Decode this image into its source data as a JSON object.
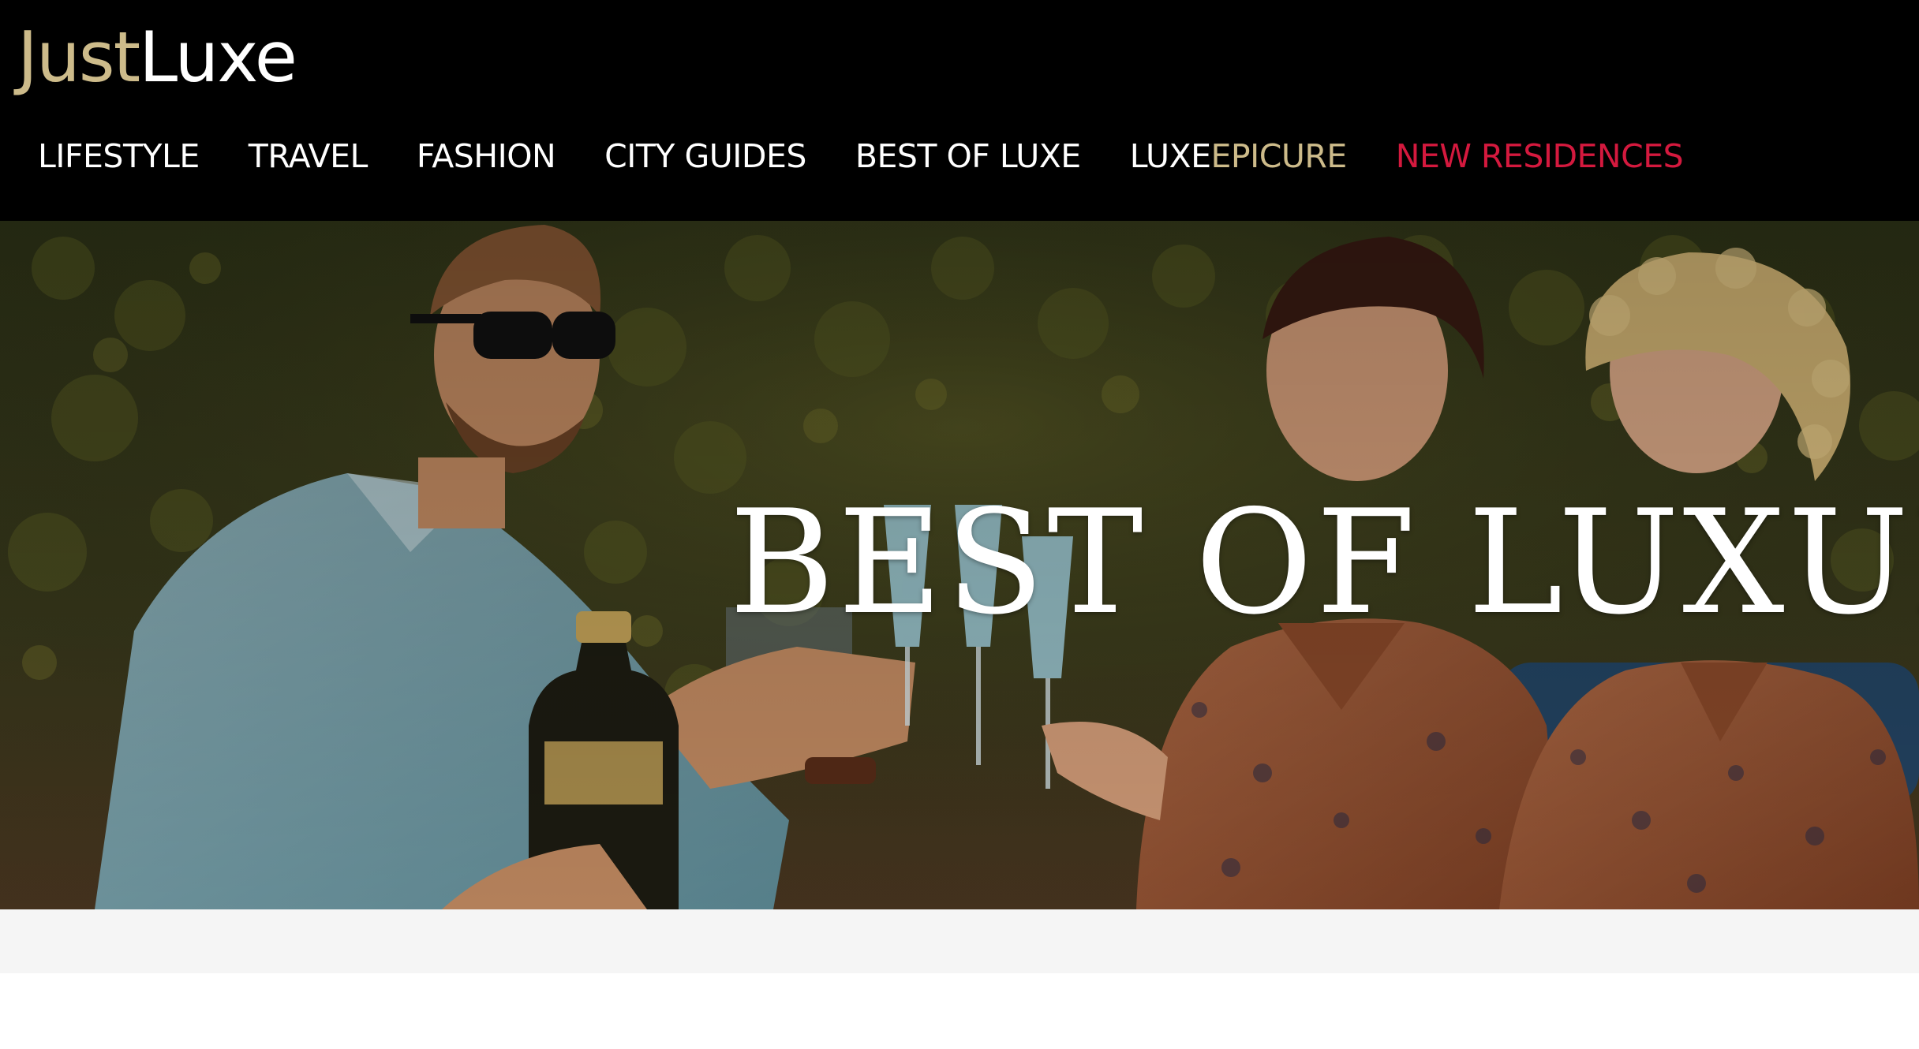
{
  "logo": {
    "part1": "Just",
    "part2": "Luxe"
  },
  "nav": {
    "lifestyle": "LIFESTYLE",
    "travel": "TRAVEL",
    "fashion": "FASHION",
    "city_guides": "CITY GUIDES",
    "best_of_luxe": "BEST OF LUXE",
    "luxe_epicure_part1": "LUXE",
    "luxe_epicure_part2": "EPICURE",
    "new_residences": "NEW RESIDENCES"
  },
  "hero": {
    "title": "BEST OF LUXURY"
  },
  "colors": {
    "header_bg": "#000000",
    "logo_gold": "#cdbb8a",
    "nav_red": "#d4193e",
    "band_grey": "#f5f5f5"
  },
  "icons": []
}
